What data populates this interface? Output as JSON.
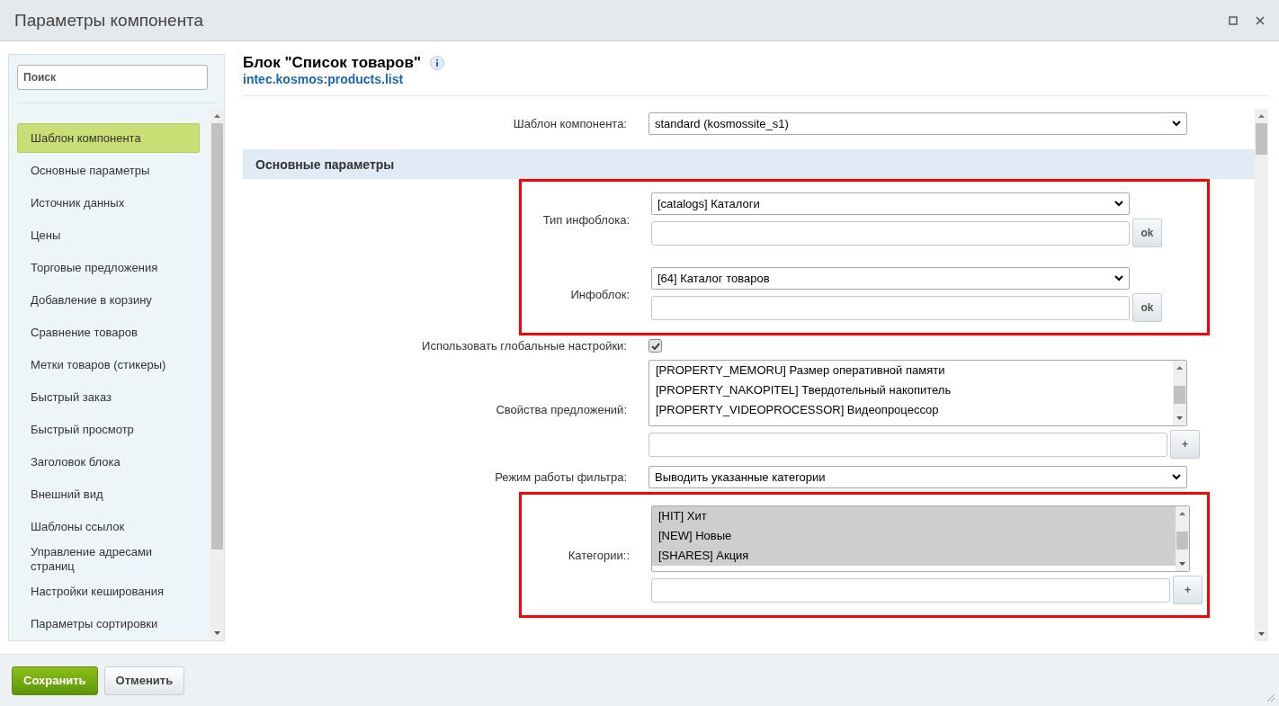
{
  "window": {
    "title": "Параметры компонента"
  },
  "sidebar": {
    "search": {
      "placeholder": "Поиск"
    },
    "items": [
      {
        "label": "Шаблон компонента",
        "selected": true
      },
      {
        "label": "Основные параметры",
        "selected": false
      },
      {
        "label": "Источник данных",
        "selected": false
      },
      {
        "label": "Цены",
        "selected": false
      },
      {
        "label": "Торговые предложения",
        "selected": false
      },
      {
        "label": "Добавление в корзину",
        "selected": false
      },
      {
        "label": "Сравнение товаров",
        "selected": false
      },
      {
        "label": "Метки товаров (стикеры)",
        "selected": false
      },
      {
        "label": "Быстрый заказ",
        "selected": false
      },
      {
        "label": "Быстрый просмотр",
        "selected": false
      },
      {
        "label": "Заголовок блока",
        "selected": false
      },
      {
        "label": "Внешний вид",
        "selected": false
      },
      {
        "label": "Шаблоны ссылок",
        "selected": false
      },
      {
        "label": "Управление адресами страниц",
        "selected": false
      },
      {
        "label": "Настройки кеширования",
        "selected": false
      },
      {
        "label": "Параметры сортировки",
        "selected": false
      }
    ]
  },
  "component": {
    "title": "Блок \"Список товаров\"",
    "code": "intec.kosmos:products.list"
  },
  "rows": [
    {
      "kind": "select",
      "label": "Шаблон компонента:",
      "value": "standard (kosmossite_s1)"
    },
    {
      "kind": "section",
      "label": "Основные параметры"
    },
    {
      "kind": "highlight",
      "rows": [
        {
          "kind": "select-input",
          "label": "Тип инфоблока:",
          "value": "[catalogs] Каталоги",
          "button": "ok"
        },
        {
          "kind": "select-input",
          "label": "Инфоблок:",
          "value": "[64] Каталог товаров",
          "button": "ok"
        }
      ]
    },
    {
      "kind": "checkbox",
      "label": "Использовать глобальные настройки:",
      "checked": true
    },
    {
      "kind": "multiselect",
      "label": "Свойства предложений:",
      "button": "+",
      "options": [
        {
          "text": "[PROPERTY_MEMORU] Размер оперативной памяти",
          "selected": false
        },
        {
          "text": "[PROPERTY_NAKOPITEL] Твердотельный накопитель",
          "selected": false
        },
        {
          "text": "[PROPERTY_VIDEOPROCESSOR] Видеопроцессор",
          "selected": false
        }
      ]
    },
    {
      "kind": "select",
      "label": "Режим работы фильтра:",
      "value": "Выводить указанные категории"
    },
    {
      "kind": "highlight",
      "rows": [
        {
          "kind": "multiselect",
          "label": "Категории::",
          "button": "+",
          "options": [
            {
              "text": "[HIT] Хит",
              "selected": true
            },
            {
              "text": "[NEW] Новые",
              "selected": true
            },
            {
              "text": "[SHARES] Акция",
              "selected": true
            }
          ]
        }
      ]
    }
  ],
  "footer": {
    "buttons": [
      {
        "label": "Сохранить",
        "kind": "primary"
      },
      {
        "label": "Отменить",
        "kind": "secondary"
      }
    ]
  }
}
